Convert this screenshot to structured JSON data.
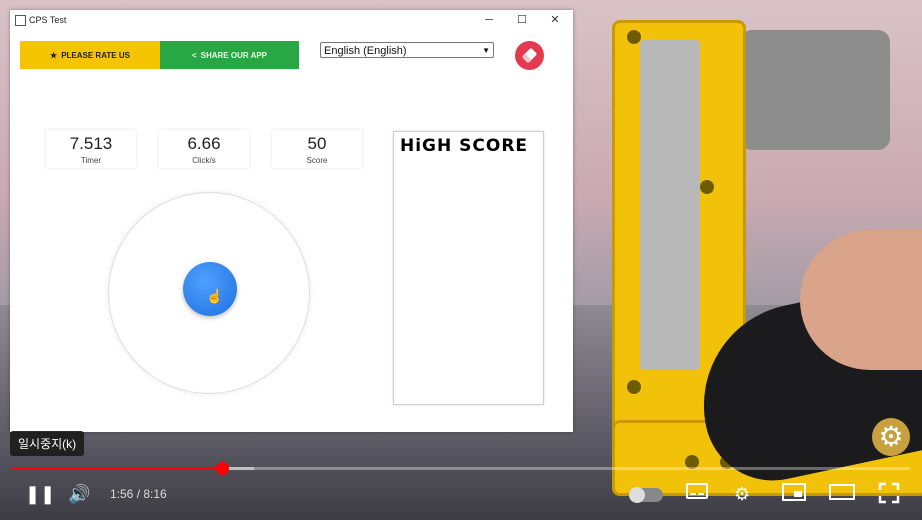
{
  "window": {
    "title": "CPS Test",
    "min_glyph": "─",
    "max_glyph": "☐",
    "close_glyph": "✕"
  },
  "header": {
    "rate_label": "PLEASE RATE US",
    "share_label": "SHARE OUR APP",
    "language_selected": "English (English)",
    "star_icon": "★",
    "share_icon": "<",
    "eraser_icon": "eraser-icon"
  },
  "stats": [
    {
      "value": "7.513",
      "label": "Timer"
    },
    {
      "value": "6.66",
      "label": "Click/s"
    },
    {
      "value": "50",
      "label": "Score"
    }
  ],
  "high_score": {
    "title": "HiGH SCORE"
  },
  "player": {
    "tooltip": "일시중지(k)",
    "current_time": "1:56",
    "duration": "8:16",
    "time_separator": " / ",
    "progress_fraction": 0.234,
    "loaded_fraction": 0.27,
    "play_pause_glyph": "❚❚",
    "volume_glyph": "🔊",
    "settings_glyph": "⚙",
    "fullscreen_glyph": "⛶",
    "accent": "#ff0000"
  },
  "colors": {
    "rate": "#f5c400",
    "share": "#27a844",
    "eraser": "#e53950",
    "click_button": "#2b7fef"
  }
}
